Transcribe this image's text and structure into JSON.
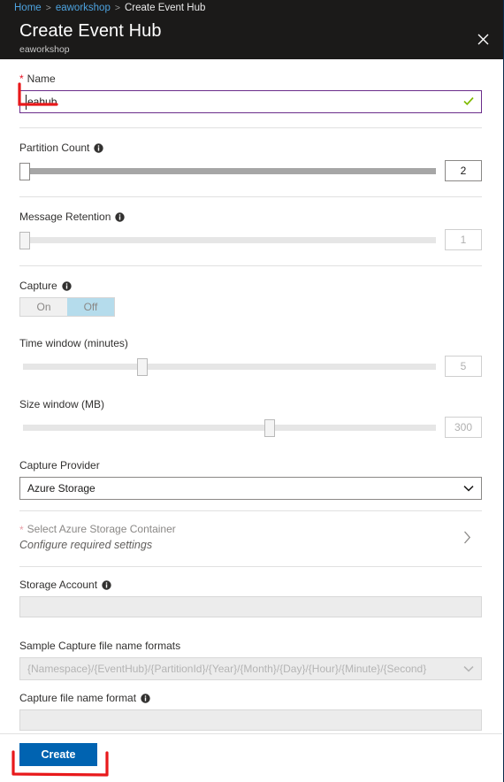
{
  "breadcrumb": {
    "items": [
      {
        "label": "Home",
        "link": true
      },
      {
        "label": "eaworkshop",
        "link": true
      },
      {
        "label": "Create Event Hub",
        "link": false
      }
    ],
    "separator": ">"
  },
  "header": {
    "title": "Create Event Hub",
    "subtitle": "eaworkshop",
    "close_icon": "close-icon"
  },
  "form": {
    "name": {
      "label": "Name",
      "required_marker": "*",
      "value": "eahub",
      "valid_icon": "check-icon"
    },
    "partition_count": {
      "label": "Partition Count",
      "info_icon": "info-icon",
      "value": "2",
      "thumb_percent": 0,
      "disabled": false
    },
    "message_retention": {
      "label": "Message Retention",
      "info_icon": "info-icon",
      "value": "1",
      "thumb_percent": 0,
      "disabled": true
    },
    "capture": {
      "label": "Capture",
      "info_icon": "info-icon",
      "options": [
        "On",
        "Off"
      ],
      "selected": "Off"
    },
    "time_window": {
      "label": "Time window (minutes)",
      "value": "5",
      "thumb_percent": 28,
      "disabled": true
    },
    "size_window": {
      "label": "Size window (MB)",
      "value": "300",
      "thumb_percent": 59,
      "disabled": true
    },
    "capture_provider": {
      "label": "Capture Provider",
      "value": "Azure Storage",
      "chevron_icon": "chevron-down-icon",
      "disabled": false
    },
    "storage_container": {
      "required_marker": "*",
      "label": "Select Azure Storage Container",
      "sublabel": "Configure required settings",
      "chevron_icon": "chevron-right-icon"
    },
    "storage_account": {
      "label": "Storage Account",
      "info_icon": "info-icon",
      "value": ""
    },
    "sample_formats": {
      "label": "Sample Capture file name formats",
      "value": "{Namespace}/{EventHub}/{PartitionId}/{Year}/{Month}/{Day}/{Hour}/{Minute}/{Second}",
      "chevron_icon": "chevron-down-icon",
      "disabled": true
    },
    "capture_file_name_format": {
      "label": "Capture file name format",
      "info_icon": "info-icon",
      "value": ""
    }
  },
  "footer": {
    "create_label": "Create"
  },
  "colors": {
    "blade_header_bg": "#1b1a19",
    "breadcrumb_link": "#4da3e0",
    "focus_border": "#6b2d8b",
    "valid_check": "#7fba00",
    "toggle_selected": "#b5dcec",
    "primary_button": "#0063b1",
    "required_star": "#e81123",
    "annotation": "#e8191b"
  }
}
